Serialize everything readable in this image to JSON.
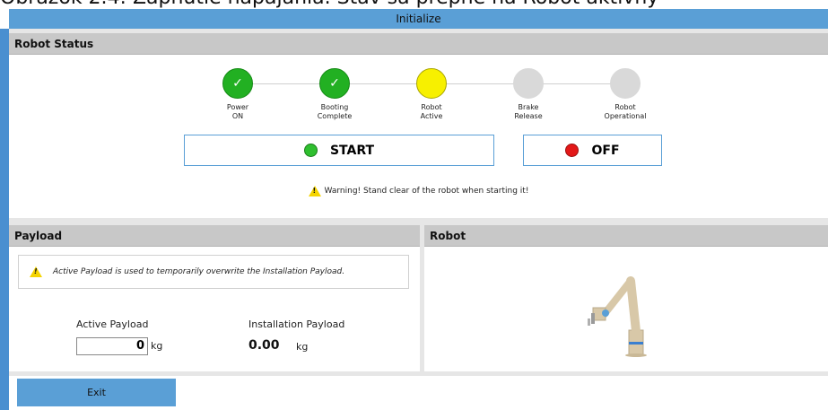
{
  "top_caption": "Obrázok 2.4: Zapnutie napájania. Stav sa prepne na Robot aktívny",
  "window": {
    "title": "Initialize"
  },
  "robot_status": {
    "header": "Robot Status",
    "steps": [
      {
        "label_line1": "Power",
        "label_line2": "ON",
        "state": "done",
        "color": "#22b022"
      },
      {
        "label_line1": "Booting",
        "label_line2": "Complete",
        "state": "done",
        "color": "#22b022"
      },
      {
        "label_line1": "Robot",
        "label_line2": "Active",
        "state": "current",
        "color": "#f7f000"
      },
      {
        "label_line1": "Brake",
        "label_line2": "Release",
        "state": "pending",
        "color": "#d9d9d9"
      },
      {
        "label_line1": "Robot",
        "label_line2": "Operational",
        "state": "pending",
        "color": "#d9d9d9"
      }
    ],
    "check_glyph": "✓",
    "start_label": "START",
    "off_label": "OFF",
    "warning_text": "Warning! Stand clear of the robot when starting it!",
    "warning_icon": "warning-triangle-icon"
  },
  "payload": {
    "header": "Payload",
    "info_text": "Active Payload is used to temporarily overwrite the Installation Payload.",
    "active_label": "Active Payload",
    "active_value": "0",
    "active_unit": "kg",
    "installation_label": "Installation Payload",
    "installation_value": "0.00",
    "installation_unit": "kg"
  },
  "robot": {
    "header": "Robot"
  },
  "footer": {
    "exit_label": "Exit"
  },
  "colors": {
    "accent": "#5a9fd6",
    "header_bg": "#c8c8c8"
  }
}
